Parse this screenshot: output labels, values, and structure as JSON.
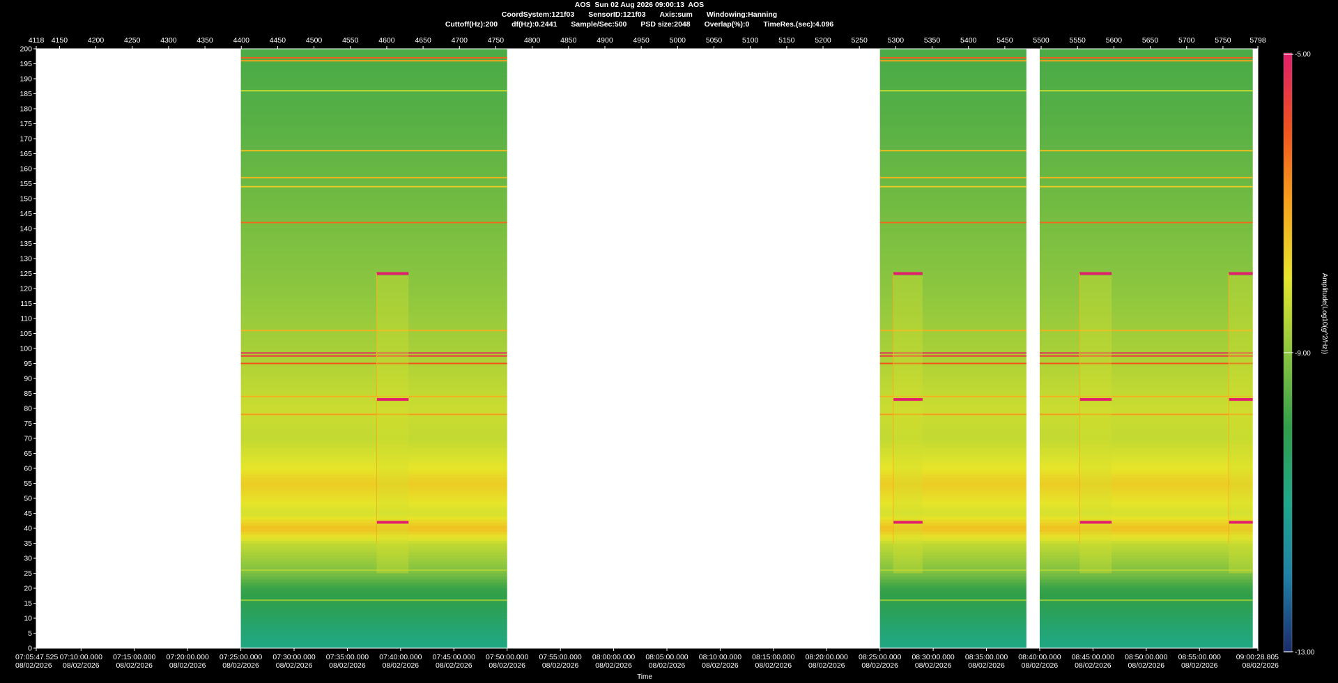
{
  "header": {
    "line1": "AOS  Sun 02 Aug 2026 09:00:13  AOS",
    "coord": "CoordSystem:121f03",
    "sensor": "SensorID:121f03",
    "axis": "Axis:sum",
    "windowing": "Windowing:Hanning",
    "cutoff": "Cuttoff(Hz):200",
    "df": "df(Hz):0.2441",
    "sample": "Sample/Sec:500",
    "psd": "PSD size:2048",
    "overlap": "Overlap(%):0",
    "timeres": "TimeRes.(sec):4.096"
  },
  "colorbar": {
    "title": "Amplitude(Log10(g^2/Hz))",
    "max_label": "-5.00",
    "mid_label": "-9.00",
    "min_label": "-13.00",
    "stops": [
      "#1b2a6b",
      "#1f7fa8",
      "#1ea88a",
      "#2f9f4a",
      "#8cc63f",
      "#e6e62a",
      "#f7a21b",
      "#f0501e",
      "#e01e6c"
    ]
  },
  "chart_data": {
    "type": "heatmap",
    "xlabel": "Time",
    "ylabel": "",
    "ylim": [
      0,
      200
    ],
    "y_ticks": [
      0,
      5,
      10,
      15,
      20,
      25,
      30,
      35,
      40,
      45,
      50,
      55,
      60,
      65,
      70,
      75,
      80,
      85,
      90,
      95,
      100,
      105,
      110,
      115,
      120,
      125,
      130,
      135,
      140,
      145,
      150,
      155,
      160,
      165,
      170,
      175,
      180,
      185,
      190,
      195,
      200
    ],
    "top_axis": {
      "range": [
        4118,
        5798
      ],
      "ticks": [
        "4118",
        "4150",
        "4200",
        "4250",
        "4300",
        "4350",
        "4400",
        "4450",
        "4500",
        "4550",
        "4600",
        "4650",
        "4700",
        "4750",
        "4800",
        "4850",
        "4900",
        "4950",
        "5000",
        "5050",
        "5100",
        "5150",
        "5200",
        "5250",
        "5300",
        "5350",
        "5400",
        "5450",
        "5500",
        "5550",
        "5600",
        "5650",
        "5700",
        "5750",
        "5798"
      ]
    },
    "bottom_axis": {
      "start": "07:05:47.525",
      "end": "09:00:28.805",
      "date": "08/02/2026",
      "ticks": [
        "07:05:47.525",
        "07:10:00.000",
        "07:15:00.000",
        "07:20:00.000",
        "07:25:00.000",
        "07:30:00.000",
        "07:35:00.000",
        "07:40:00.000",
        "07:45:00.000",
        "07:50:00.000",
        "07:55:00.000",
        "08:00:00.000",
        "08:05:00.000",
        "08:10:00.000",
        "08:15:00.000",
        "08:20:00.000",
        "08:25:00.000",
        "08:30:00.000",
        "08:35:00.000",
        "08:40:00.000",
        "08:45:00.000",
        "08:50:00.000",
        "08:55:00.000",
        "09:00:28.805"
      ]
    },
    "color_range": [
      -13,
      -5
    ],
    "data_segments": [
      {
        "from": "07:25:00",
        "to": "07:50:00"
      },
      {
        "from": "08:25:00",
        "to": "08:38:45"
      },
      {
        "from": "08:40:00",
        "to": "09:00:00"
      }
    ],
    "profile_levels": [
      {
        "hz": 0,
        "level": -10.9
      },
      {
        "hz": 5,
        "level": -10.7
      },
      {
        "hz": 10,
        "level": -10.4
      },
      {
        "hz": 15,
        "level": -10.1
      },
      {
        "hz": 20,
        "level": -9.9
      },
      {
        "hz": 25,
        "level": -9.2
      },
      {
        "hz": 30,
        "level": -8.8
      },
      {
        "hz": 35,
        "level": -8.4
      },
      {
        "hz": 40,
        "level": -7.4
      },
      {
        "hz": 45,
        "level": -8.2
      },
      {
        "hz": 50,
        "level": -7.9
      },
      {
        "hz": 55,
        "level": -7.6
      },
      {
        "hz": 60,
        "level": -8.0
      },
      {
        "hz": 70,
        "level": -8.4
      },
      {
        "hz": 80,
        "level": -8.3
      },
      {
        "hz": 90,
        "level": -8.5
      },
      {
        "hz": 100,
        "level": -8.7
      },
      {
        "hz": 120,
        "level": -9.0
      },
      {
        "hz": 140,
        "level": -9.2
      },
      {
        "hz": 160,
        "level": -9.4
      },
      {
        "hz": 180,
        "level": -9.6
      },
      {
        "hz": 200,
        "level": -9.7
      }
    ],
    "lines": [
      {
        "hz": 197,
        "level": -6.2
      },
      {
        "hz": 196,
        "level": -7.0
      },
      {
        "hz": 142,
        "level": -6.3
      },
      {
        "hz": 98.5,
        "level": -5.2
      },
      {
        "hz": 97.5,
        "level": -5.6
      },
      {
        "hz": 95,
        "level": -6.0
      },
      {
        "hz": 106,
        "level": -7.2
      },
      {
        "hz": 84,
        "level": -7.2
      },
      {
        "hz": 78,
        "level": -6.9
      },
      {
        "hz": 157,
        "level": -7.3
      },
      {
        "hz": 154,
        "level": -7.6
      },
      {
        "hz": 166,
        "level": -7.4
      },
      {
        "hz": 186,
        "level": -8.4
      },
      {
        "hz": 26,
        "level": -8.6
      },
      {
        "hz": 16,
        "level": -8.9
      }
    ],
    "events": [
      {
        "from": "07:37:45",
        "to": "07:40:45",
        "lines": [
          125,
          83,
          42
        ]
      },
      {
        "from": "08:26:15",
        "to": "08:29:00",
        "lines": [
          125,
          83,
          42
        ]
      },
      {
        "from": "08:43:45",
        "to": "08:46:45",
        "lines": [
          125,
          83,
          42
        ]
      },
      {
        "from": "08:57:45",
        "to": "09:00:00",
        "lines": [
          125,
          83,
          42
        ]
      }
    ]
  }
}
